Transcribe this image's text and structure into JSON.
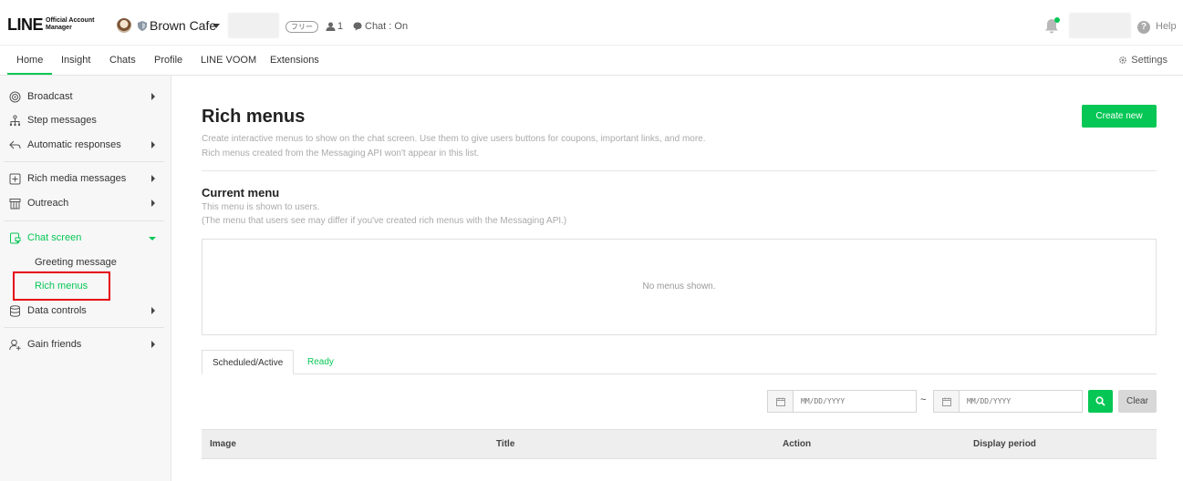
{
  "header": {
    "logo_main": "LINE",
    "logo_sub_1": "Official Account",
    "logo_sub_2": "Manager",
    "account_name": "Brown Cafe",
    "plan_badge": "フリー",
    "friend_count": "1",
    "chat_status": "Chat : On",
    "help_label": "Help"
  },
  "nav": {
    "tabs": [
      {
        "label": "Home"
      },
      {
        "label": "Insight"
      },
      {
        "label": "Chats"
      },
      {
        "label": "Profile"
      },
      {
        "label": "LINE VOOM"
      },
      {
        "label": "Extensions"
      }
    ],
    "active_tab": "Home",
    "settings_label": "Settings"
  },
  "sidebar": {
    "items": [
      {
        "label": "Broadcast",
        "icon": "broadcast-icon"
      },
      {
        "label": "Step messages",
        "icon": "step-messages-icon"
      },
      {
        "label": "Automatic responses",
        "icon": "auto-response-icon"
      },
      {
        "label": "Rich media messages",
        "icon": "rich-media-icon"
      },
      {
        "label": "Outreach",
        "icon": "outreach-icon"
      },
      {
        "label": "Chat screen",
        "icon": "chat-screen-icon"
      },
      {
        "label": "Data controls",
        "icon": "database-icon"
      },
      {
        "label": "Gain friends",
        "icon": "add-friend-icon"
      }
    ],
    "sub_items": [
      {
        "label": "Greeting message"
      },
      {
        "label": "Rich menus"
      }
    ],
    "active_section": "Chat screen",
    "active_sub_item": "Rich menus"
  },
  "main": {
    "title": "Rich menus",
    "create_button": "Create new",
    "description_1": "Create interactive menus to show on the chat screen. Use them to give users buttons for coupons, important links, and more.",
    "description_2": "Rich menus created from the Messaging API won't appear in this list.",
    "current_menu": {
      "title": "Current menu",
      "note_1": "This menu is shown to users.",
      "note_2": "(The menu that users see may differ if you've created rich menus with the Messaging API.)",
      "empty_text": "No menus shown."
    },
    "tabs": [
      {
        "label": "Scheduled/Active"
      },
      {
        "label": "Ready"
      }
    ],
    "filter": {
      "start_placeholder": "MM/DD/YYYY",
      "end_placeholder": "MM/DD/YYYY",
      "separator": "~",
      "clear_label": "Clear"
    },
    "table": {
      "columns": [
        "Image",
        "Title",
        "Action",
        "Display period"
      ]
    }
  },
  "colors": {
    "accent": "#06c755",
    "highlight_border": "#e60012"
  }
}
